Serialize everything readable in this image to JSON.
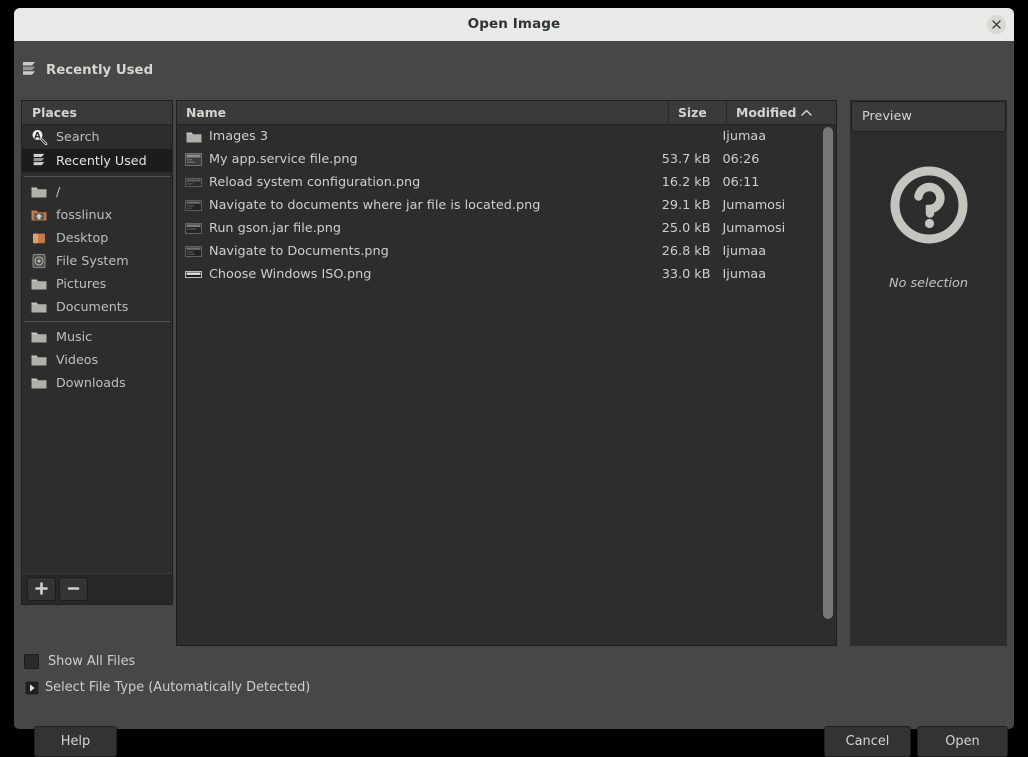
{
  "window": {
    "title": "Open Image",
    "close_icon": "close-icon"
  },
  "location_bar": {
    "icon": "recently-used-icon",
    "label": "Recently Used"
  },
  "sidebar": {
    "header": "Places",
    "items": [
      {
        "label": "Search",
        "icon": "search-icon",
        "selected": false
      },
      {
        "label": "Recently Used",
        "icon": "recently-used-icon",
        "selected": true
      },
      {
        "label": "/",
        "icon": "folder-icon",
        "selected": false
      },
      {
        "label": "fosslinux",
        "icon": "home-folder-icon",
        "selected": false
      },
      {
        "label": "Desktop",
        "icon": "desktop-folder-icon",
        "selected": false
      },
      {
        "label": "File System",
        "icon": "disk-icon",
        "selected": false
      },
      {
        "label": "Pictures",
        "icon": "folder-icon",
        "selected": false
      },
      {
        "label": "Documents",
        "icon": "folder-icon",
        "selected": false
      },
      {
        "label": "Music",
        "icon": "folder-icon",
        "selected": false
      },
      {
        "label": "Videos",
        "icon": "folder-icon",
        "selected": false
      },
      {
        "label": "Downloads",
        "icon": "folder-icon",
        "selected": false
      }
    ],
    "add_button": "plus-icon",
    "remove_button": "minus-icon"
  },
  "file_list": {
    "columns": {
      "name": "Name",
      "size": "Size",
      "modified": "Modified"
    },
    "sort_column": "Modified",
    "sort_direction": "ascending",
    "sort_icon": "chevron-up-icon",
    "rows": [
      {
        "name": "Images 3",
        "size": "",
        "modified": "Ijumaa",
        "icon": "folder-icon"
      },
      {
        "name": "My app.service file.png",
        "size": "53.7 kB",
        "modified": "06:26",
        "icon": "image-icon"
      },
      {
        "name": "Reload system configuration.png",
        "size": "16.2 kB",
        "modified": "06:11",
        "icon": "image-icon"
      },
      {
        "name": "Navigate to documents where jar file is located.png",
        "size": "29.1 kB",
        "modified": "Jumamosi",
        "icon": "image-icon"
      },
      {
        "name": "Run gson.jar file.png",
        "size": "25.0 kB",
        "modified": "Jumamosi",
        "icon": "image-icon"
      },
      {
        "name": "Navigate to Documents.png",
        "size": "26.8 kB",
        "modified": "Ijumaa",
        "icon": "image-icon"
      },
      {
        "name": "Choose Windows ISO.png",
        "size": "33.0 kB",
        "modified": "Ijumaa",
        "icon": "image-icon"
      }
    ]
  },
  "preview": {
    "header": "Preview",
    "icon": "question-mark-icon",
    "caption": "No selection"
  },
  "options": {
    "show_all_files": {
      "label": "Show All Files",
      "checked": false
    },
    "select_file_type": {
      "label": "Select File Type (Automatically Detected)",
      "expanded": false,
      "icon": "expander-icon"
    }
  },
  "actions": {
    "help": "Help",
    "cancel": "Cancel",
    "open": "Open"
  },
  "colors": {
    "titlebar_bg": "#e9e9e7",
    "dialog_bg": "#474747",
    "panel_bg": "#2d2d2d",
    "header_bg": "#3a3a3a",
    "selected_bg": "#1c1c1c",
    "text": "#cfcfca",
    "folder_accent": "#b0b0ab",
    "home_accent": "#c9784a"
  }
}
